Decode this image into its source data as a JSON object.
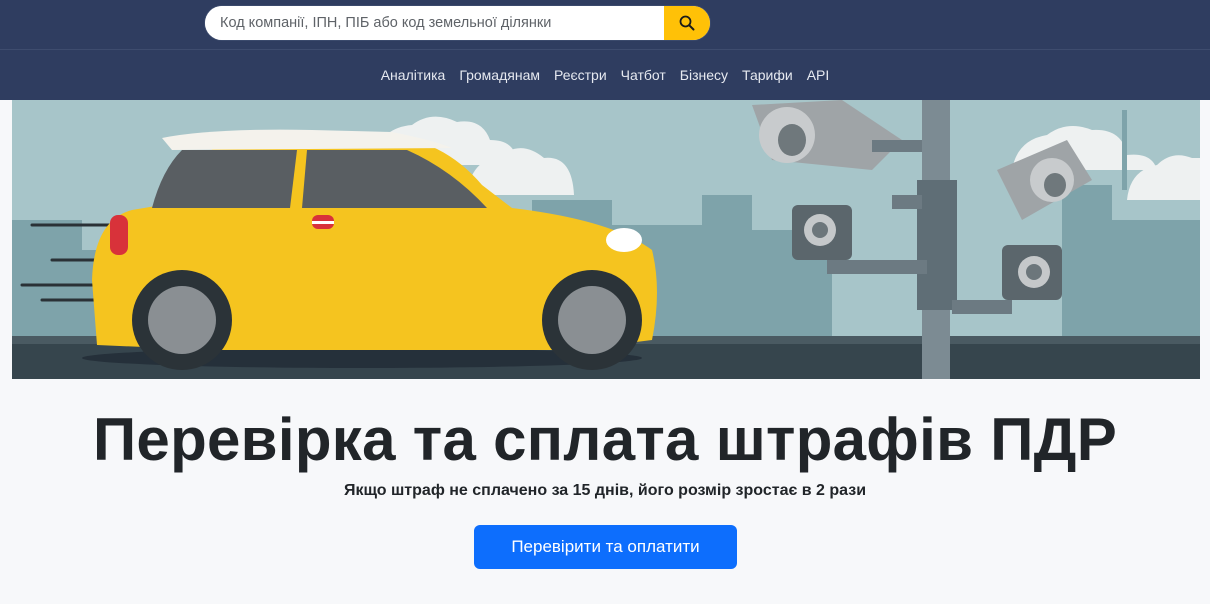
{
  "search": {
    "placeholder": "Код компанії, ІПН, ПІБ або код земельної ділянки",
    "button_icon": "search-icon"
  },
  "nav": {
    "items": [
      {
        "label": "Аналітика"
      },
      {
        "label": "Громадянам"
      },
      {
        "label": "Реєстри"
      },
      {
        "label": "Чатбот"
      },
      {
        "label": "Бізнесу"
      },
      {
        "label": "Тарифи"
      },
      {
        "label": "API"
      }
    ]
  },
  "hero": {
    "image": "yellow-car-and-traffic-cameras-illustration"
  },
  "main": {
    "title": "Перевірка та сплата штрафів ПДР",
    "subtitle": "Якщо штраф не сплачено за 15 днів, його розмір зростає в 2 рази",
    "cta_label": "Перевірити та оплатити"
  },
  "colors": {
    "header_bg": "#2f3d60",
    "search_button": "#ffc107",
    "cta": "#0d6efd",
    "car": "#f5c41f",
    "sky": "#a6c4c8"
  }
}
